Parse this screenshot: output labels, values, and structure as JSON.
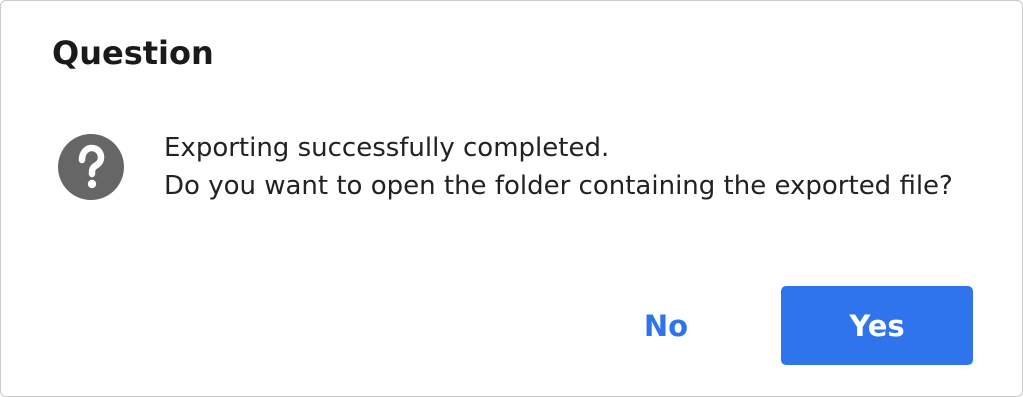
{
  "dialog": {
    "title": "Question",
    "icon": "question-icon",
    "message_lines": [
      "Exporting successfully completed.",
      "Do you want to open the folder containing the exported file?"
    ],
    "buttons": {
      "no_label": "No",
      "yes_label": "Yes"
    },
    "colors": {
      "accent": "#2f74ea",
      "icon_bg": "#666666"
    }
  }
}
